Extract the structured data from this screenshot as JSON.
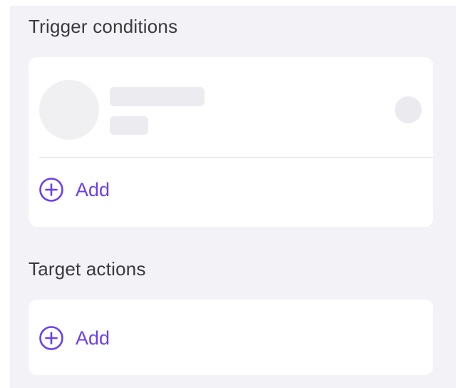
{
  "trigger_section": {
    "title": "Trigger conditions",
    "add_label": "Add"
  },
  "target_section": {
    "title": "Target actions",
    "add_label": "Add"
  },
  "colors": {
    "accent": "#6b3ff0",
    "background": "#f2f2f7",
    "card": "#ffffff",
    "skeleton": "#ececf0",
    "title_text": "#3a3a3c"
  },
  "icons": {
    "add": "plus-circle-icon"
  }
}
